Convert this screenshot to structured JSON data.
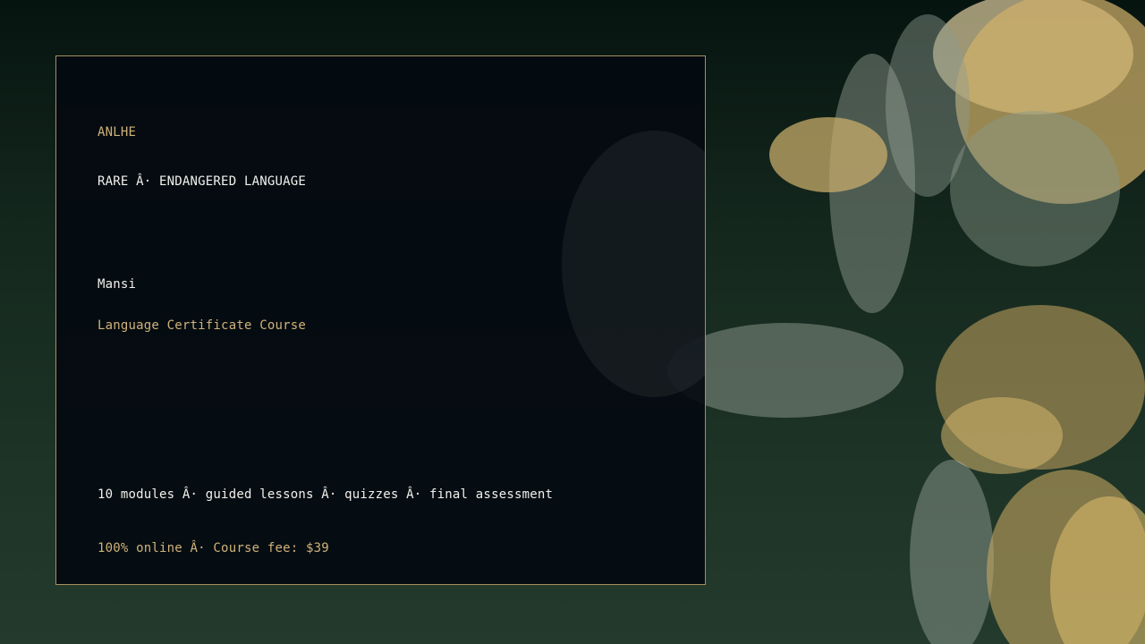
{
  "brand": "ANLHE",
  "category": "RARE Â· ENDANGERED LANGUAGE",
  "language": "Mansi",
  "course_title": "Language Certificate Course",
  "features": "10 modules Â· guided lessons Â· quizzes Â· final assessment",
  "pricing": "100% online Â· Course fee: $39",
  "colors": {
    "accent_gold": "#cfb27a",
    "border_gold": "#a58f5d",
    "background_green": "#1d3326",
    "card": "#040a10",
    "text_white": "#f1f1ec"
  }
}
